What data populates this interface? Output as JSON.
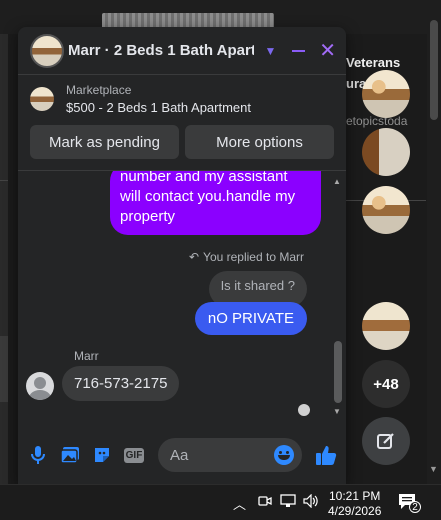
{
  "chat": {
    "title": "Marr · 2 Beds 1 Bath Apart…",
    "marketplace_label": "Marketplace",
    "listing": "$500 - 2 Beds 1 Bath Apartment",
    "actions": [
      "Mark as pending",
      "More options"
    ],
    "messages": {
      "outgoing_text": "number and my assistant will contact you.handle my property",
      "replied_to": "You replied to Marr",
      "quoted": "Is it shared ?",
      "reply": "nO PRIVATE",
      "sender": "Marr",
      "incoming": "716-573-2175"
    },
    "composer_placeholder": "Aa",
    "gif_label": "GIF"
  },
  "background": {
    "heading": "Veterans",
    "subheading": "ura",
    "subtext": "etopicstoda",
    "more_count": "+48"
  },
  "taskbar": {
    "time": "10:21 PM",
    "date": "4/29/2026",
    "notifications": "2"
  },
  "colors": {
    "accent_purple": "#8b00ff",
    "accent_blue": "#3a5bf0",
    "icon_blue": "#2e89ff"
  }
}
